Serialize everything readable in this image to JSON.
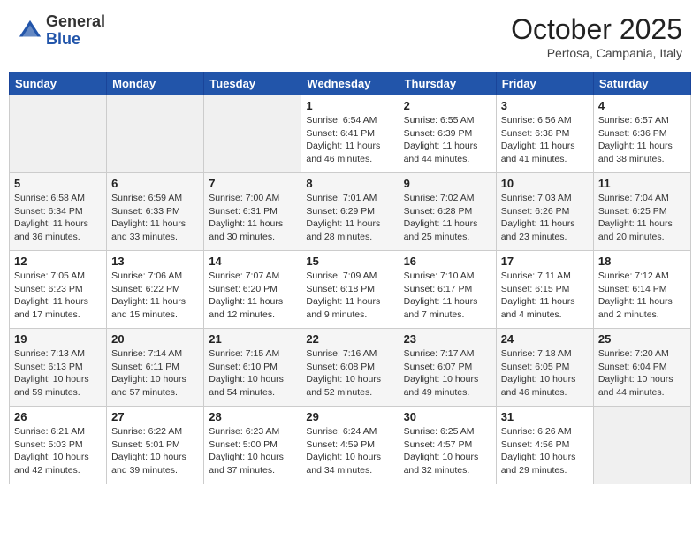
{
  "header": {
    "logo_general": "General",
    "logo_blue": "Blue",
    "month": "October 2025",
    "location": "Pertosa, Campania, Italy"
  },
  "days_of_week": [
    "Sunday",
    "Monday",
    "Tuesday",
    "Wednesday",
    "Thursday",
    "Friday",
    "Saturday"
  ],
  "weeks": [
    [
      {
        "day": "",
        "info": ""
      },
      {
        "day": "",
        "info": ""
      },
      {
        "day": "",
        "info": ""
      },
      {
        "day": "1",
        "info": "Sunrise: 6:54 AM\nSunset: 6:41 PM\nDaylight: 11 hours\nand 46 minutes."
      },
      {
        "day": "2",
        "info": "Sunrise: 6:55 AM\nSunset: 6:39 PM\nDaylight: 11 hours\nand 44 minutes."
      },
      {
        "day": "3",
        "info": "Sunrise: 6:56 AM\nSunset: 6:38 PM\nDaylight: 11 hours\nand 41 minutes."
      },
      {
        "day": "4",
        "info": "Sunrise: 6:57 AM\nSunset: 6:36 PM\nDaylight: 11 hours\nand 38 minutes."
      }
    ],
    [
      {
        "day": "5",
        "info": "Sunrise: 6:58 AM\nSunset: 6:34 PM\nDaylight: 11 hours\nand 36 minutes."
      },
      {
        "day": "6",
        "info": "Sunrise: 6:59 AM\nSunset: 6:33 PM\nDaylight: 11 hours\nand 33 minutes."
      },
      {
        "day": "7",
        "info": "Sunrise: 7:00 AM\nSunset: 6:31 PM\nDaylight: 11 hours\nand 30 minutes."
      },
      {
        "day": "8",
        "info": "Sunrise: 7:01 AM\nSunset: 6:29 PM\nDaylight: 11 hours\nand 28 minutes."
      },
      {
        "day": "9",
        "info": "Sunrise: 7:02 AM\nSunset: 6:28 PM\nDaylight: 11 hours\nand 25 minutes."
      },
      {
        "day": "10",
        "info": "Sunrise: 7:03 AM\nSunset: 6:26 PM\nDaylight: 11 hours\nand 23 minutes."
      },
      {
        "day": "11",
        "info": "Sunrise: 7:04 AM\nSunset: 6:25 PM\nDaylight: 11 hours\nand 20 minutes."
      }
    ],
    [
      {
        "day": "12",
        "info": "Sunrise: 7:05 AM\nSunset: 6:23 PM\nDaylight: 11 hours\nand 17 minutes."
      },
      {
        "day": "13",
        "info": "Sunrise: 7:06 AM\nSunset: 6:22 PM\nDaylight: 11 hours\nand 15 minutes."
      },
      {
        "day": "14",
        "info": "Sunrise: 7:07 AM\nSunset: 6:20 PM\nDaylight: 11 hours\nand 12 minutes."
      },
      {
        "day": "15",
        "info": "Sunrise: 7:09 AM\nSunset: 6:18 PM\nDaylight: 11 hours\nand 9 minutes."
      },
      {
        "day": "16",
        "info": "Sunrise: 7:10 AM\nSunset: 6:17 PM\nDaylight: 11 hours\nand 7 minutes."
      },
      {
        "day": "17",
        "info": "Sunrise: 7:11 AM\nSunset: 6:15 PM\nDaylight: 11 hours\nand 4 minutes."
      },
      {
        "day": "18",
        "info": "Sunrise: 7:12 AM\nSunset: 6:14 PM\nDaylight: 11 hours\nand 2 minutes."
      }
    ],
    [
      {
        "day": "19",
        "info": "Sunrise: 7:13 AM\nSunset: 6:13 PM\nDaylight: 10 hours\nand 59 minutes."
      },
      {
        "day": "20",
        "info": "Sunrise: 7:14 AM\nSunset: 6:11 PM\nDaylight: 10 hours\nand 57 minutes."
      },
      {
        "day": "21",
        "info": "Sunrise: 7:15 AM\nSunset: 6:10 PM\nDaylight: 10 hours\nand 54 minutes."
      },
      {
        "day": "22",
        "info": "Sunrise: 7:16 AM\nSunset: 6:08 PM\nDaylight: 10 hours\nand 52 minutes."
      },
      {
        "day": "23",
        "info": "Sunrise: 7:17 AM\nSunset: 6:07 PM\nDaylight: 10 hours\nand 49 minutes."
      },
      {
        "day": "24",
        "info": "Sunrise: 7:18 AM\nSunset: 6:05 PM\nDaylight: 10 hours\nand 46 minutes."
      },
      {
        "day": "25",
        "info": "Sunrise: 7:20 AM\nSunset: 6:04 PM\nDaylight: 10 hours\nand 44 minutes."
      }
    ],
    [
      {
        "day": "26",
        "info": "Sunrise: 6:21 AM\nSunset: 5:03 PM\nDaylight: 10 hours\nand 42 minutes."
      },
      {
        "day": "27",
        "info": "Sunrise: 6:22 AM\nSunset: 5:01 PM\nDaylight: 10 hours\nand 39 minutes."
      },
      {
        "day": "28",
        "info": "Sunrise: 6:23 AM\nSunset: 5:00 PM\nDaylight: 10 hours\nand 37 minutes."
      },
      {
        "day": "29",
        "info": "Sunrise: 6:24 AM\nSunset: 4:59 PM\nDaylight: 10 hours\nand 34 minutes."
      },
      {
        "day": "30",
        "info": "Sunrise: 6:25 AM\nSunset: 4:57 PM\nDaylight: 10 hours\nand 32 minutes."
      },
      {
        "day": "31",
        "info": "Sunrise: 6:26 AM\nSunset: 4:56 PM\nDaylight: 10 hours\nand 29 minutes."
      },
      {
        "day": "",
        "info": ""
      }
    ]
  ]
}
